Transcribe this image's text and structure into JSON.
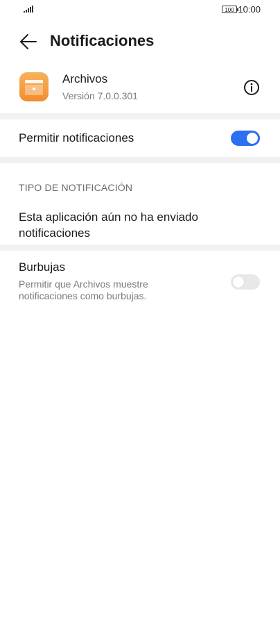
{
  "status_bar": {
    "battery": "100",
    "time": "10:00"
  },
  "header": {
    "title": "Notificaciones",
    "back_icon": "arrow-left-icon"
  },
  "app": {
    "name": "Archivos",
    "version": "Versión 7.0.0.301",
    "icon": "files-app-icon",
    "icon_color": "#F5A043",
    "info_icon": "info-icon"
  },
  "allow_notifications": {
    "label": "Permitir notificaciones",
    "enabled": true,
    "accent": "#2D6FF2"
  },
  "notification_type": {
    "header": "TIPO DE NOTIFICACIÓN",
    "message": "Esta aplicación aún no ha enviado notificaciones"
  },
  "bubbles": {
    "title": "Burbujas",
    "description": "Permitir que Archivos muestre notificaciones como burbujas.",
    "enabled": false
  }
}
